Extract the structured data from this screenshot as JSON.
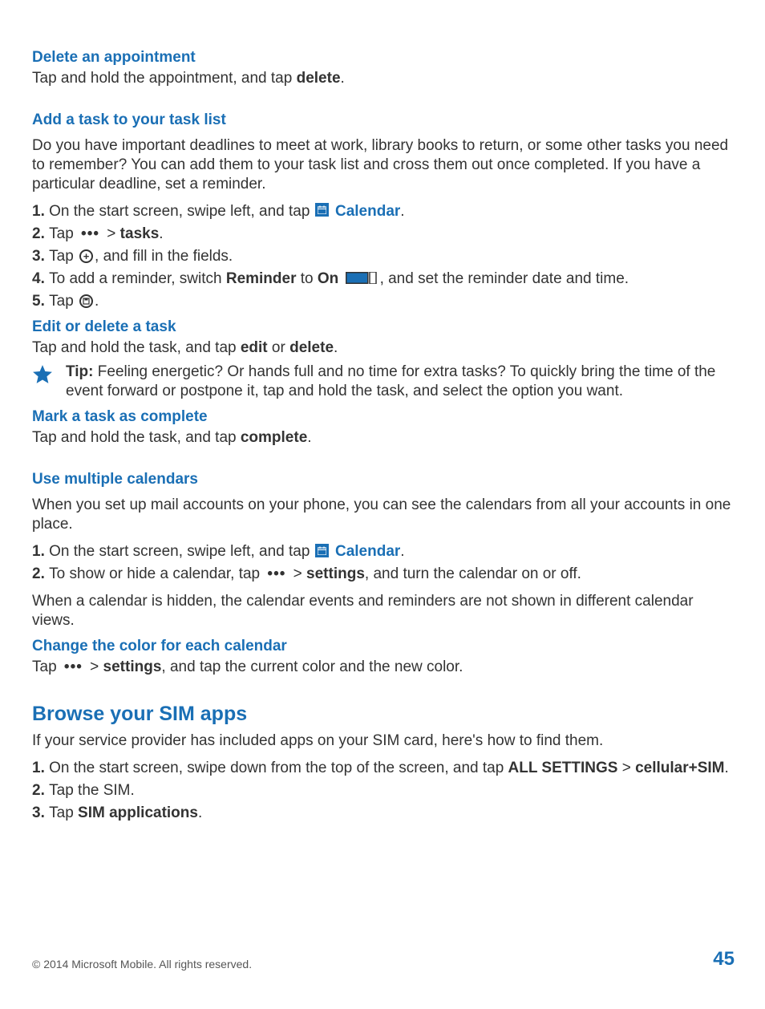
{
  "delete_appt": {
    "heading": "Delete an appointment",
    "body_a": "Tap and hold the appointment, and tap ",
    "body_b": "delete",
    "body_c": "."
  },
  "add_task": {
    "heading": "Add a task to your task list",
    "intro": "Do you have important deadlines to meet at work, library books to return, or some other tasks you need to remember? You can add them to your task list and cross them out once completed. If you have a particular deadline, set a reminder.",
    "s1_num": "1. ",
    "s1_a": "On the start screen, swipe left, and tap ",
    "s1_b": "Calendar",
    "s1_c": ".",
    "s2_num": "2. ",
    "s2_a": "Tap ",
    "s2_gt": " > ",
    "s2_b": "tasks",
    "s2_c": ".",
    "s3_num": "3. ",
    "s3_a": "Tap ",
    "s3_b": ", and fill in the fields.",
    "s4_num": "4. ",
    "s4_a": "To add a reminder, switch ",
    "s4_b": "Reminder",
    "s4_c": " to ",
    "s4_d": "On",
    "s4_e": " ",
    "s4_f": ", and set the reminder date and time.",
    "s5_num": "5. ",
    "s5_a": "Tap ",
    "s5_b": "."
  },
  "edit_task": {
    "heading": "Edit or delete a task",
    "body_a": "Tap and hold the task, and tap ",
    "body_b": "edit",
    "body_c": " or ",
    "body_d": "delete",
    "body_e": "."
  },
  "tip": {
    "label": "Tip: ",
    "text": "Feeling energetic? Or hands full and no time for extra tasks? To quickly bring the time of the event forward or postpone it, tap and hold the task, and select the option you want."
  },
  "mark_complete": {
    "heading": "Mark a task as complete",
    "body_a": "Tap and hold the task, and tap ",
    "body_b": "complete",
    "body_c": "."
  },
  "multi_cal": {
    "heading": "Use multiple calendars",
    "intro": "When you set up mail accounts on your phone, you can see the calendars from all your accounts in one place.",
    "s1_num": "1. ",
    "s1_a": "On the start screen, swipe left, and tap ",
    "s1_b": "Calendar",
    "s1_c": ".",
    "s2_num": "2. ",
    "s2_a": "To show or hide a calendar, tap ",
    "s2_gt": " > ",
    "s2_b": "settings",
    "s2_c": ", and turn the calendar on or off.",
    "note": "When a calendar is hidden, the calendar events and reminders are not shown in different calendar views."
  },
  "change_color": {
    "heading": "Change the color for each calendar",
    "body_a": "Tap ",
    "body_gt": " > ",
    "body_b": "settings",
    "body_c": ", and tap the current color and the new color."
  },
  "sim": {
    "heading": "Browse your SIM apps",
    "intro": "If your service provider has included apps on your SIM card, here's how to find them.",
    "s1_num": "1. ",
    "s1_a": "On the start screen, swipe down from the top of the screen, and tap ",
    "s1_b": "ALL SETTINGS",
    "s1_c": " > ",
    "s1_d": "cellular+SIM",
    "s1_e": ".",
    "s2_num": "2. ",
    "s2_a": "Tap the SIM.",
    "s3_num": "3. ",
    "s3_a": "Tap ",
    "s3_b": "SIM applications",
    "s3_c": "."
  },
  "footer": {
    "copyright": "© 2014 Microsoft Mobile. All rights reserved.",
    "page": "45"
  }
}
